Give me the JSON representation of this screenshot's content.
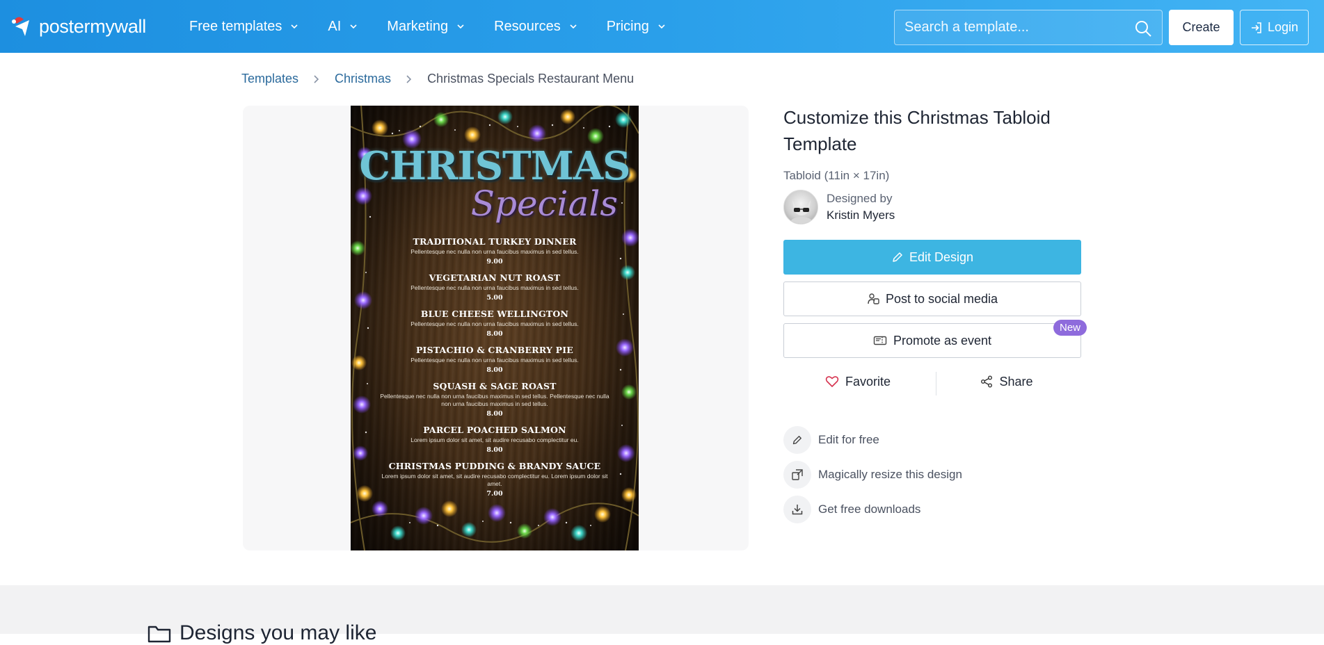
{
  "header": {
    "logo_text": "postermywall",
    "nav": [
      {
        "label": "Free templates"
      },
      {
        "label": "AI"
      },
      {
        "label": "Marketing"
      },
      {
        "label": "Resources"
      },
      {
        "label": "Pricing"
      }
    ],
    "search_placeholder": "Search a template...",
    "create_label": "Create",
    "login_label": "Login",
    "brand_color": "#2a9fea"
  },
  "breadcrumb": {
    "items": [
      "Templates",
      "Christmas"
    ],
    "current": "Christmas Specials Restaurant Menu"
  },
  "poster": {
    "title": "CHRISTMAS",
    "subtitle": "Specials",
    "items": [
      {
        "name": "TRADITIONAL TURKEY DINNER",
        "desc": "Pellentesque nec nulla non urna faucibus maximus in sed tellus.",
        "price": "9.00"
      },
      {
        "name": "VEGETARIAN NUT ROAST",
        "desc": "Pellentesque nec nulla non urna faucibus maximus in sed tellus.",
        "price": "5.00"
      },
      {
        "name": "BLUE CHEESE WELLINGTON",
        "desc": "Pellentesque nec nulla non urna faucibus maximus in sed tellus.",
        "price": "8.00"
      },
      {
        "name": "PISTACHIO & CRANBERRY PIE",
        "desc": "Pellentesque nec nulla non urna faucibus maximus in sed tellus.",
        "price": "8.00"
      },
      {
        "name": "SQUASH & SAGE ROAST",
        "desc": "Pellentesque nec nulla non urna faucibus maximus in sed tellus. Pellentesque nec nulla non urna faucibus maximus in sed tellus.",
        "price": "8.00"
      },
      {
        "name": "PARCEL POACHED SALMON",
        "desc": "Lorem ipsum dolor sit amet, sit audire recusabo complectitur eu.",
        "price": "8.00"
      },
      {
        "name": "CHRISTMAS PUDDING & BRANDY SAUCE",
        "desc": "Lorem ipsum dolor sit amet, sit audire recusabo complectitur eu. Lorem ipsum dolor sit amet.",
        "price": "7.00"
      }
    ]
  },
  "details": {
    "title": "Customize this Christmas Tabloid Template",
    "size": "Tabloid (11in × 17in)",
    "designed_by": "Designed by",
    "designer_name": "Kristin Myers",
    "edit_label": "Edit Design",
    "post_label": "Post to social media",
    "promote_label": "Promote as event",
    "new_badge": "New",
    "favorite_label": "Favorite",
    "share_label": "Share",
    "features": [
      {
        "label": "Edit for free",
        "icon": "pencil-icon"
      },
      {
        "label": "Magically resize this design",
        "icon": "resize-icon"
      },
      {
        "label": "Get free downloads",
        "icon": "download-icon"
      }
    ],
    "accent_color": "#3db5e2",
    "badge_color": "#8e6bdc"
  },
  "section": {
    "designs_you_may_like": "Designs you may like"
  }
}
